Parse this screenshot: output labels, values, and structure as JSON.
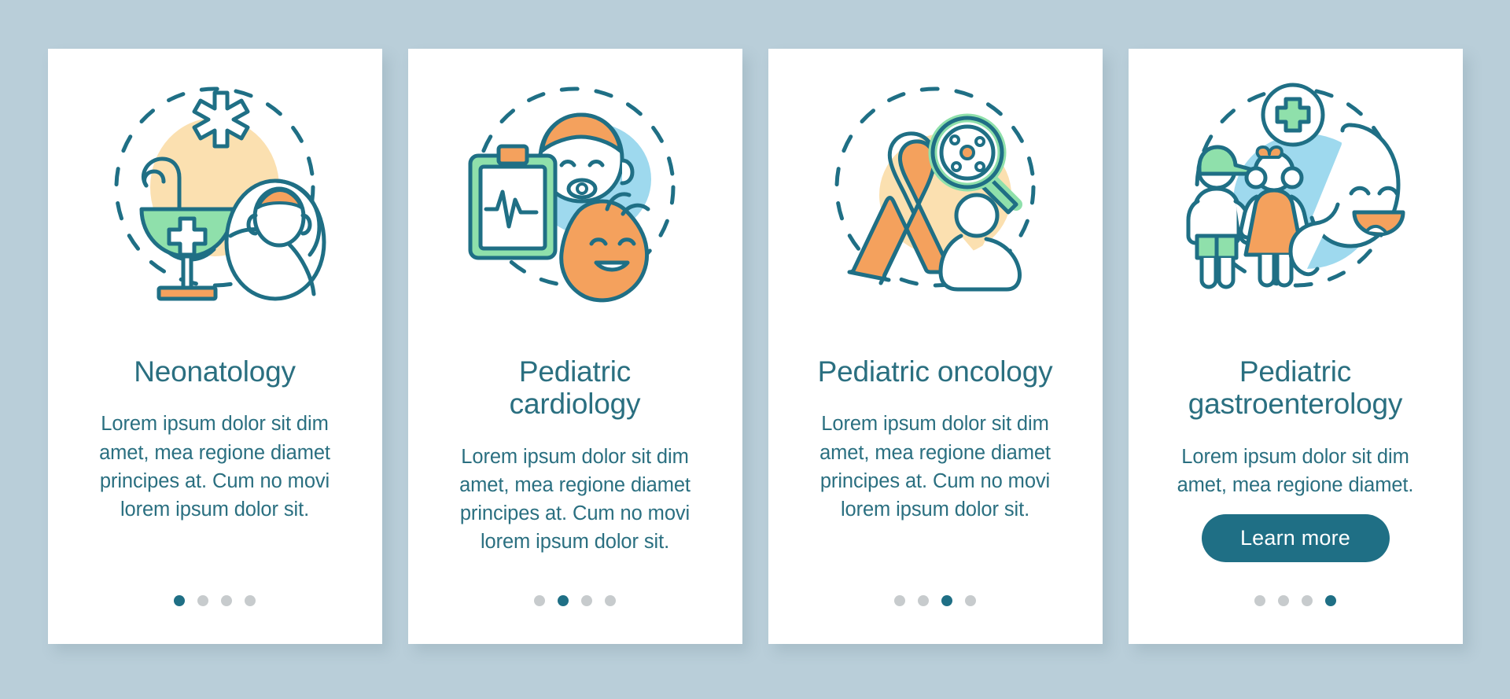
{
  "background_color": "#b9ced9",
  "theme": {
    "accent_teal": "#1f6f85",
    "text_teal": "#2a6f80",
    "green": "#8fe0ab",
    "orange": "#f4a15d",
    "light_blue": "#9ed9ee",
    "cream": "#fbe0b0",
    "dot_inactive": "#c7cbcd",
    "card_bg": "#ffffff"
  },
  "screens": [
    {
      "id": "neonatology",
      "illustration": "neonatology-illustration",
      "title": "Neonatology",
      "body": "Lorem ipsum dolor sit dim amet, mea regione diamet principes at. Cum no movi lorem ipsum dolor sit.",
      "has_button": false,
      "button_label": "",
      "dots": {
        "count": 4,
        "active_index": 0
      }
    },
    {
      "id": "pediatric-cardiology",
      "illustration": "pediatric-cardiology-illustration",
      "title": "Pediatric\ncardiology",
      "body": "Lorem ipsum dolor sit dim amet, mea regione diamet principes at. Cum no movi lorem ipsum dolor sit.",
      "has_button": false,
      "button_label": "",
      "dots": {
        "count": 4,
        "active_index": 1
      }
    },
    {
      "id": "pediatric-oncology",
      "illustration": "pediatric-oncology-illustration",
      "title": "Pediatric oncology",
      "body": "Lorem ipsum dolor sit dim amet, mea regione diamet principes at. Cum no movi lorem ipsum dolor sit.",
      "has_button": false,
      "button_label": "",
      "dots": {
        "count": 4,
        "active_index": 2
      }
    },
    {
      "id": "pediatric-gastroenterology",
      "illustration": "pediatric-gastroenterology-illustration",
      "title": "Pediatric\ngastroenterology",
      "body": "Lorem ipsum dolor sit dim amet, mea regione diamet.",
      "has_button": true,
      "button_label": "Learn more",
      "dots": {
        "count": 4,
        "active_index": 3
      }
    }
  ]
}
